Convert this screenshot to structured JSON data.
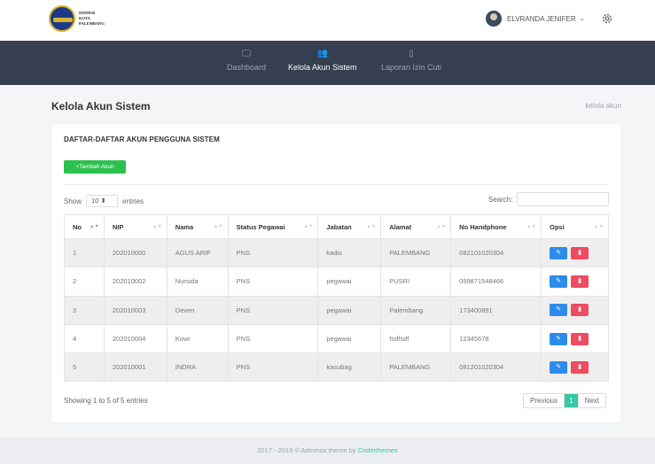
{
  "brand": {
    "line1": "DINHUB",
    "line2": "KOTA",
    "line3": "PALEMBANG"
  },
  "user": {
    "name": "ELVRANDA JENIFER",
    "caret": "⌄"
  },
  "nav": [
    {
      "icon": "🖵",
      "label": "Dashboard",
      "active": false
    },
    {
      "icon": "👥",
      "label": "Kelola Akun Sistem",
      "active": true
    },
    {
      "icon": "▯",
      "label": "Laporan Izin Cuti",
      "active": false
    }
  ],
  "page": {
    "title": "Kelola Akun Sistem",
    "breadcrumb": "kelola akun"
  },
  "card": {
    "title": "DAFTAR-DAFTAR AKUN PENGGUNA SISTEM",
    "add_label": "+Tambah Akun",
    "show_label": "Show",
    "show_value": "10",
    "entries_label": "entries",
    "search_label": "Search:",
    "columns": [
      "No",
      "NIP",
      "Nama",
      "Status Pegawai",
      "Jabatan",
      "Alamat",
      "No Handphone",
      "Opsi"
    ],
    "rows": [
      {
        "no": "1",
        "nip": "202010000",
        "nama": "AGUS ARIF",
        "status": "PNS",
        "jabatan": "kadis",
        "alamat": "PALEMBANG",
        "hp": "082101020304"
      },
      {
        "no": "2",
        "nip": "202010002",
        "nama": "Nursida",
        "status": "PNS",
        "jabatan": "pegawai",
        "alamat": "PUSRI",
        "hp": "059871548466"
      },
      {
        "no": "3",
        "nip": "202010003",
        "nama": "Deven",
        "status": "PNS",
        "jabatan": "pegawai",
        "alamat": "Palembang",
        "hp": "173400891"
      },
      {
        "no": "4",
        "nip": "202010004",
        "nama": "Kowi",
        "status": "PNS",
        "jabatan": "pegawai",
        "alamat": "fsdfsdf",
        "hp": "12345678"
      },
      {
        "no": "5",
        "nip": "202010001",
        "nama": "INDRA",
        "status": "PNS",
        "jabatan": "kasubag",
        "alamat": "PALEMBANG",
        "hp": "081201020304"
      }
    ],
    "info": "Showing 1 to 5 of 5 entries",
    "pager": {
      "previous": "Previous",
      "page": "1",
      "next": "Next"
    }
  },
  "footer": {
    "text": "2017 - 2019 © Adminox theme by ",
    "link": "Coderthemes"
  },
  "colors": {
    "navbar": "#353f4f",
    "add": "#2cc14f",
    "edit": "#2d8ceb",
    "delete": "#ef4b61",
    "accent": "#34c8a4"
  }
}
